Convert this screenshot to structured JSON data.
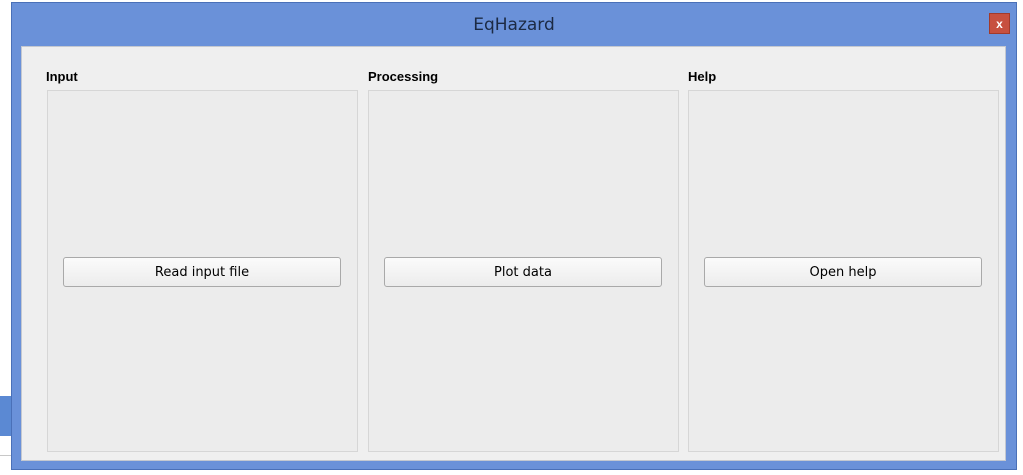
{
  "window": {
    "title": "EqHazard",
    "close_label": "x"
  },
  "groups": [
    {
      "label": "Input",
      "button_label": "Read input file"
    },
    {
      "label": "Processing",
      "button_label": "Plot data"
    },
    {
      "label": "Help",
      "button_label": "Open help"
    }
  ],
  "colors": {
    "titlebar": "#6a91d9",
    "close_button": "#c7503f",
    "client_background": "#efefef"
  }
}
